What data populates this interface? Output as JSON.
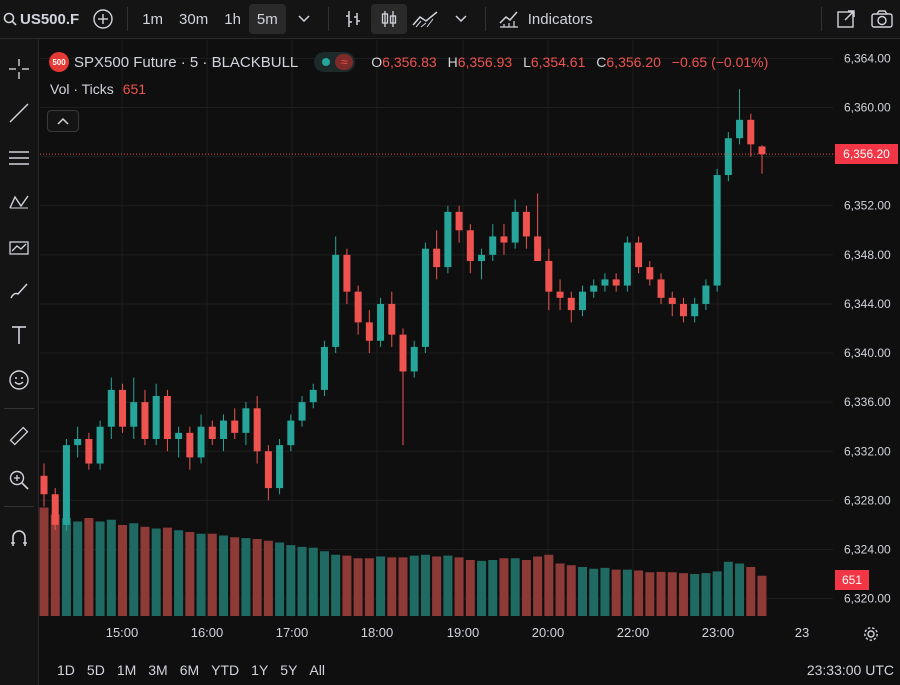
{
  "topbar": {
    "symbol": "US500.F",
    "timeframes": [
      "1m",
      "30m",
      "1h",
      "5m"
    ],
    "active_timeframe": "5m",
    "indicators_label": "Indicators"
  },
  "legend": {
    "badge": "500",
    "title": "SPX500 Future · 5 · BLACKBULL",
    "o_label": "O",
    "o_value": "6,356.83",
    "h_label": "H",
    "h_value": "6,356.93",
    "l_label": "L",
    "l_value": "6,354.61",
    "c_label": "C",
    "c_value": "6,356.20",
    "change": "−0.65 (−0.01%)",
    "vol_label": "Vol · Ticks",
    "vol_value": "651"
  },
  "price_axis": {
    "labels": [
      "6,364.00",
      "6,360.00",
      "6,356.00",
      "6,352.00",
      "6,348.00",
      "6,344.00",
      "6,340.00",
      "6,336.00",
      "6,332.00",
      "6,328.00",
      "6,324.00",
      "6,320.00"
    ],
    "last_price": "6,356.20",
    "last_volume": "651"
  },
  "time_axis": {
    "labels": [
      "15:00",
      "16:00",
      "17:00",
      "18:00",
      "19:00",
      "20:00",
      "22:00",
      "23:00",
      "23"
    ]
  },
  "ranges": [
    "1D",
    "5D",
    "1M",
    "3M",
    "6M",
    "YTD",
    "1Y",
    "5Y",
    "All"
  ],
  "clock": "23:33:00 UTC",
  "colors": {
    "up": "#26a69a",
    "down": "#ef5350",
    "up_vol": "#1f6b63",
    "down_vol": "#8e3b38"
  },
  "chart_data": {
    "type": "candlestick",
    "ylim": [
      6318.5,
      6365.5
    ],
    "candles": [
      [
        6330.0,
        6331.0,
        6327.5,
        6328.5
      ],
      [
        6328.5,
        6329.0,
        6325.6,
        6326.0
      ],
      [
        6326.0,
        6333.0,
        6325.5,
        6332.5
      ],
      [
        6332.5,
        6334.0,
        6331.5,
        6333.0
      ],
      [
        6333.0,
        6333.5,
        6330.5,
        6331.0
      ],
      [
        6331.0,
        6334.5,
        6330.5,
        6334.0
      ],
      [
        6334.0,
        6338.0,
        6333.0,
        6337.0
      ],
      [
        6337.0,
        6337.5,
        6333.5,
        6334.0
      ],
      [
        6334.0,
        6338.0,
        6333.0,
        6336.0
      ],
      [
        6336.0,
        6337.0,
        6332.5,
        6333.0
      ],
      [
        6333.0,
        6337.5,
        6332.5,
        6336.5
      ],
      [
        6336.5,
        6337.0,
        6332.0,
        6333.0
      ],
      [
        6333.0,
        6334.0,
        6331.5,
        6333.5
      ],
      [
        6333.5,
        6334.0,
        6330.5,
        6331.5
      ],
      [
        6331.5,
        6335.0,
        6331.0,
        6334.0
      ],
      [
        6334.0,
        6334.5,
        6332.5,
        6333.0
      ],
      [
        6333.0,
        6335.0,
        6332.0,
        6334.5
      ],
      [
        6334.5,
        6335.5,
        6333.0,
        6333.5
      ],
      [
        6333.5,
        6336.0,
        6332.5,
        6335.5
      ],
      [
        6335.5,
        6336.5,
        6331.0,
        6332.0
      ],
      [
        6332.0,
        6332.5,
        6328.0,
        6329.0
      ],
      [
        6329.0,
        6333.0,
        6328.5,
        6332.5
      ],
      [
        6332.5,
        6335.0,
        6332.0,
        6334.5
      ],
      [
        6334.5,
        6336.5,
        6334.0,
        6336.0
      ],
      [
        6336.0,
        6337.5,
        6335.5,
        6337.0
      ],
      [
        6337.0,
        6341.0,
        6336.5,
        6340.5
      ],
      [
        6340.5,
        6349.5,
        6340.0,
        6348.0
      ],
      [
        6348.0,
        6348.5,
        6344.0,
        6345.0
      ],
      [
        6345.0,
        6345.5,
        6341.5,
        6342.5
      ],
      [
        6342.5,
        6343.5,
        6340.0,
        6341.0
      ],
      [
        6341.0,
        6344.5,
        6340.5,
        6344.0
      ],
      [
        6344.0,
        6345.0,
        6340.5,
        6341.5
      ],
      [
        6341.5,
        6342.0,
        6332.5,
        6338.5
      ],
      [
        6338.5,
        6341.0,
        6338.0,
        6340.5
      ],
      [
        6340.5,
        6349.0,
        6340.0,
        6348.5
      ],
      [
        6348.5,
        6350.0,
        6346.0,
        6347.0
      ],
      [
        6347.0,
        6352.0,
        6346.5,
        6351.5
      ],
      [
        6351.5,
        6352.0,
        6349.0,
        6350.0
      ],
      [
        6350.0,
        6350.5,
        6346.5,
        6347.5
      ],
      [
        6347.5,
        6348.5,
        6346.0,
        6348.0
      ],
      [
        6348.0,
        6350.5,
        6347.5,
        6349.5
      ],
      [
        6349.5,
        6350.5,
        6348.0,
        6349.0
      ],
      [
        6349.0,
        6352.5,
        6348.5,
        6351.5
      ],
      [
        6351.5,
        6352.0,
        6348.5,
        6349.5
      ],
      [
        6349.5,
        6353.0,
        6348.5,
        6347.5
      ],
      [
        6347.5,
        6348.5,
        6343.5,
        6345.0
      ],
      [
        6345.0,
        6346.0,
        6343.5,
        6344.5
      ],
      [
        6344.5,
        6345.0,
        6342.5,
        6343.5
      ],
      [
        6343.5,
        6345.5,
        6343.0,
        6345.0
      ],
      [
        6345.0,
        6346.0,
        6344.5,
        6345.5
      ],
      [
        6345.5,
        6346.5,
        6345.0,
        6346.0
      ],
      [
        6346.0,
        6346.5,
        6345.0,
        6345.5
      ],
      [
        6345.5,
        6349.5,
        6345.0,
        6349.0
      ],
      [
        6349.0,
        6349.5,
        6346.5,
        6347.0
      ],
      [
        6347.0,
        6347.5,
        6345.5,
        6346.0
      ],
      [
        6346.0,
        6346.5,
        6344.0,
        6344.5
      ],
      [
        6344.5,
        6345.0,
        6343.0,
        6344.0
      ],
      [
        6344.0,
        6344.5,
        6342.5,
        6343.0
      ],
      [
        6343.0,
        6344.5,
        6342.5,
        6344.0
      ],
      [
        6344.0,
        6346.0,
        6343.5,
        6345.5
      ],
      [
        6345.5,
        6355.0,
        6345.0,
        6354.5
      ],
      [
        6354.5,
        6358.0,
        6354.0,
        6357.5
      ],
      [
        6357.5,
        6361.5,
        6357.0,
        6359.0
      ],
      [
        6359.0,
        6359.5,
        6356.0,
        6357.0
      ],
      [
        6356.83,
        6356.93,
        6354.61,
        6356.2
      ]
    ],
    "volumes": [
      620,
      580,
      560,
      540,
      560,
      540,
      550,
      520,
      530,
      510,
      500,
      505,
      490,
      480,
      470,
      470,
      460,
      450,
      445,
      440,
      430,
      420,
      405,
      395,
      390,
      370,
      350,
      345,
      330,
      330,
      340,
      335,
      335,
      345,
      350,
      340,
      345,
      335,
      320,
      315,
      320,
      330,
      330,
      320,
      340,
      350,
      300,
      290,
      280,
      270,
      275,
      265,
      265,
      260,
      250,
      252,
      250,
      245,
      240,
      245,
      255,
      310,
      300,
      280,
      230
    ],
    "price_labels": [
      "6,364.00",
      "6,360.00",
      "6,356.00",
      "6,352.00",
      "6,348.00",
      "6,344.00",
      "6,340.00",
      "6,336.00",
      "6,332.00",
      "6,328.00",
      "6,324.00",
      "6,320.00"
    ],
    "time_labels": [
      "15:00",
      "16:00",
      "17:00",
      "18:00",
      "19:00",
      "20:00",
      "22:00",
      "23:00",
      "23"
    ]
  }
}
